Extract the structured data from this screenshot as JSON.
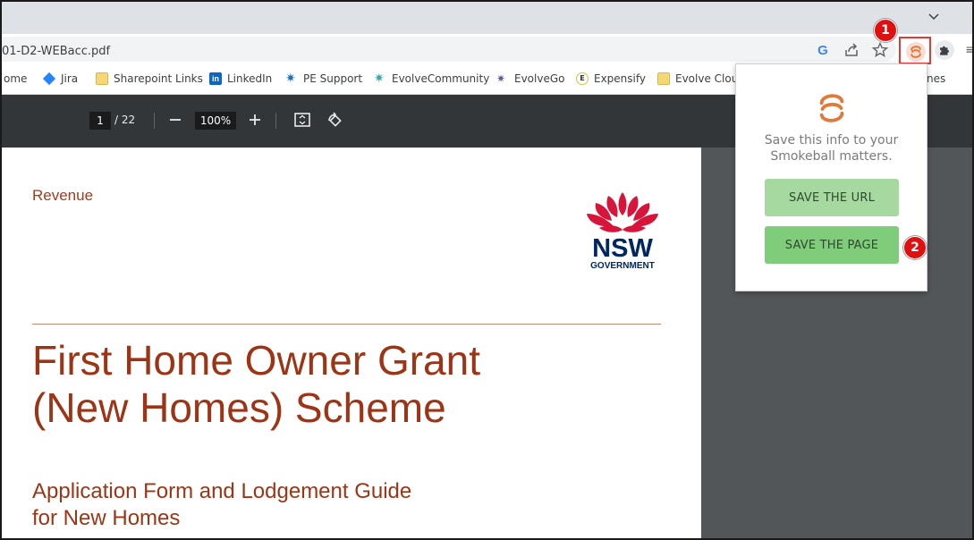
{
  "browser": {
    "address_text": "01-D2-WEBacc.pdf",
    "menu_chevron": "⌄",
    "google_glyph": "G",
    "share_glyph": "⇪",
    "star_glyph": "☆",
    "menu_glyph": "≡"
  },
  "bookmarks": [
    {
      "label": "Home",
      "visible_text": "ome",
      "icon": "home-icon"
    },
    {
      "label": "Jira",
      "icon": "jira-icon"
    },
    {
      "label": "Sharepoint Links",
      "icon": "folder-icon"
    },
    {
      "label": "LinkedIn",
      "icon": "linkedin-icon"
    },
    {
      "label": "PE Support",
      "icon": "gear-icon"
    },
    {
      "label": "EvolveCommunity",
      "icon": "gear-icon"
    },
    {
      "label": "EvolveGo",
      "icon": "gear-icon"
    },
    {
      "label": "Expensify",
      "icon": "expensify-icon"
    },
    {
      "label": "Evolve Cloud",
      "icon": "folder-icon"
    }
  ],
  "bookmarks_overflow_text": "nes",
  "pdf_toolbar": {
    "page_current": "1",
    "page_total": "/ 22",
    "zoom": "100%",
    "zoom_out": "—",
    "zoom_in": "+"
  },
  "pdf_page": {
    "header_label": "Revenue",
    "logo_text_main": "NSW",
    "logo_text_sub": "GOVERNMENT",
    "title_line1": "First Home Owner Grant",
    "title_line2": "(New Homes) Scheme",
    "subtitle_line1": "Application Form and Lodgement Guide",
    "subtitle_line2": "for New Homes"
  },
  "popup": {
    "message_line1": "Save this info to your",
    "message_line2": "Smokeball matters.",
    "save_url_label": "SAVE THE URL",
    "save_page_label": "SAVE THE PAGE"
  },
  "markers": {
    "one": "1",
    "two": "2"
  },
  "colors": {
    "accent_red": "#e01010",
    "pdf_title": "#9e3416",
    "button_light_green": "#a5d99f",
    "button_green": "#7fcc7a",
    "smokeball_orange": "#e07a3a"
  }
}
